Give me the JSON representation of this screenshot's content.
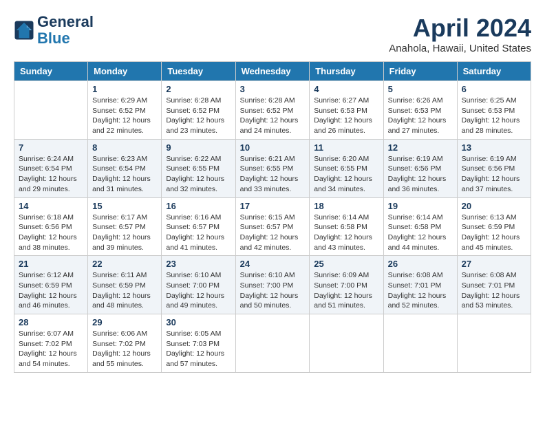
{
  "header": {
    "logo_line1": "General",
    "logo_line2": "Blue",
    "month_year": "April 2024",
    "location": "Anahola, Hawaii, United States"
  },
  "weekdays": [
    "Sunday",
    "Monday",
    "Tuesday",
    "Wednesday",
    "Thursday",
    "Friday",
    "Saturday"
  ],
  "weeks": [
    [
      {
        "num": "",
        "detail": ""
      },
      {
        "num": "1",
        "detail": "Sunrise: 6:29 AM\nSunset: 6:52 PM\nDaylight: 12 hours\nand 22 minutes."
      },
      {
        "num": "2",
        "detail": "Sunrise: 6:28 AM\nSunset: 6:52 PM\nDaylight: 12 hours\nand 23 minutes."
      },
      {
        "num": "3",
        "detail": "Sunrise: 6:28 AM\nSunset: 6:52 PM\nDaylight: 12 hours\nand 24 minutes."
      },
      {
        "num": "4",
        "detail": "Sunrise: 6:27 AM\nSunset: 6:53 PM\nDaylight: 12 hours\nand 26 minutes."
      },
      {
        "num": "5",
        "detail": "Sunrise: 6:26 AM\nSunset: 6:53 PM\nDaylight: 12 hours\nand 27 minutes."
      },
      {
        "num": "6",
        "detail": "Sunrise: 6:25 AM\nSunset: 6:53 PM\nDaylight: 12 hours\nand 28 minutes."
      }
    ],
    [
      {
        "num": "7",
        "detail": "Sunrise: 6:24 AM\nSunset: 6:54 PM\nDaylight: 12 hours\nand 29 minutes."
      },
      {
        "num": "8",
        "detail": "Sunrise: 6:23 AM\nSunset: 6:54 PM\nDaylight: 12 hours\nand 31 minutes."
      },
      {
        "num": "9",
        "detail": "Sunrise: 6:22 AM\nSunset: 6:55 PM\nDaylight: 12 hours\nand 32 minutes."
      },
      {
        "num": "10",
        "detail": "Sunrise: 6:21 AM\nSunset: 6:55 PM\nDaylight: 12 hours\nand 33 minutes."
      },
      {
        "num": "11",
        "detail": "Sunrise: 6:20 AM\nSunset: 6:55 PM\nDaylight: 12 hours\nand 34 minutes."
      },
      {
        "num": "12",
        "detail": "Sunrise: 6:19 AM\nSunset: 6:56 PM\nDaylight: 12 hours\nand 36 minutes."
      },
      {
        "num": "13",
        "detail": "Sunrise: 6:19 AM\nSunset: 6:56 PM\nDaylight: 12 hours\nand 37 minutes."
      }
    ],
    [
      {
        "num": "14",
        "detail": "Sunrise: 6:18 AM\nSunset: 6:56 PM\nDaylight: 12 hours\nand 38 minutes."
      },
      {
        "num": "15",
        "detail": "Sunrise: 6:17 AM\nSunset: 6:57 PM\nDaylight: 12 hours\nand 39 minutes."
      },
      {
        "num": "16",
        "detail": "Sunrise: 6:16 AM\nSunset: 6:57 PM\nDaylight: 12 hours\nand 41 minutes."
      },
      {
        "num": "17",
        "detail": "Sunrise: 6:15 AM\nSunset: 6:57 PM\nDaylight: 12 hours\nand 42 minutes."
      },
      {
        "num": "18",
        "detail": "Sunrise: 6:14 AM\nSunset: 6:58 PM\nDaylight: 12 hours\nand 43 minutes."
      },
      {
        "num": "19",
        "detail": "Sunrise: 6:14 AM\nSunset: 6:58 PM\nDaylight: 12 hours\nand 44 minutes."
      },
      {
        "num": "20",
        "detail": "Sunrise: 6:13 AM\nSunset: 6:59 PM\nDaylight: 12 hours\nand 45 minutes."
      }
    ],
    [
      {
        "num": "21",
        "detail": "Sunrise: 6:12 AM\nSunset: 6:59 PM\nDaylight: 12 hours\nand 46 minutes."
      },
      {
        "num": "22",
        "detail": "Sunrise: 6:11 AM\nSunset: 6:59 PM\nDaylight: 12 hours\nand 48 minutes."
      },
      {
        "num": "23",
        "detail": "Sunrise: 6:10 AM\nSunset: 7:00 PM\nDaylight: 12 hours\nand 49 minutes."
      },
      {
        "num": "24",
        "detail": "Sunrise: 6:10 AM\nSunset: 7:00 PM\nDaylight: 12 hours\nand 50 minutes."
      },
      {
        "num": "25",
        "detail": "Sunrise: 6:09 AM\nSunset: 7:00 PM\nDaylight: 12 hours\nand 51 minutes."
      },
      {
        "num": "26",
        "detail": "Sunrise: 6:08 AM\nSunset: 7:01 PM\nDaylight: 12 hours\nand 52 minutes."
      },
      {
        "num": "27",
        "detail": "Sunrise: 6:08 AM\nSunset: 7:01 PM\nDaylight: 12 hours\nand 53 minutes."
      }
    ],
    [
      {
        "num": "28",
        "detail": "Sunrise: 6:07 AM\nSunset: 7:02 PM\nDaylight: 12 hours\nand 54 minutes."
      },
      {
        "num": "29",
        "detail": "Sunrise: 6:06 AM\nSunset: 7:02 PM\nDaylight: 12 hours\nand 55 minutes."
      },
      {
        "num": "30",
        "detail": "Sunrise: 6:05 AM\nSunset: 7:03 PM\nDaylight: 12 hours\nand 57 minutes."
      },
      {
        "num": "",
        "detail": ""
      },
      {
        "num": "",
        "detail": ""
      },
      {
        "num": "",
        "detail": ""
      },
      {
        "num": "",
        "detail": ""
      }
    ]
  ]
}
